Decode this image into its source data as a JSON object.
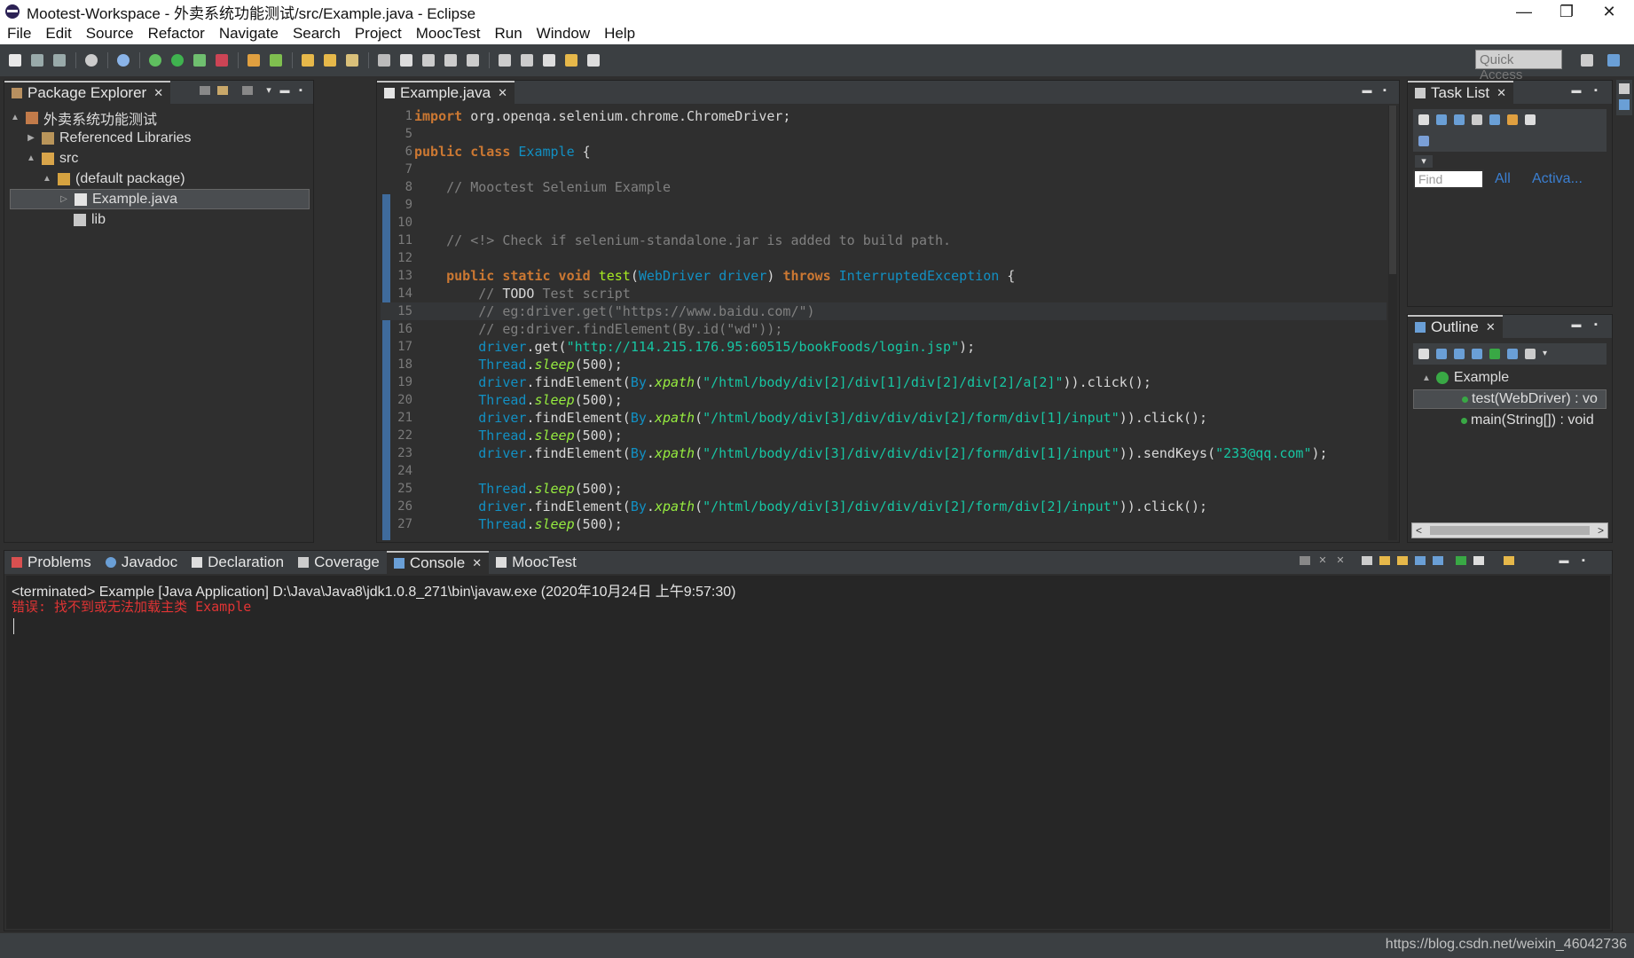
{
  "window": {
    "title": "Mootest-Workspace - 外卖系统功能测试/src/Example.java - Eclipse",
    "controls": {
      "minimize": "—",
      "maximize": "❐",
      "close": "✕"
    }
  },
  "menubar": [
    "File",
    "Edit",
    "Source",
    "Refactor",
    "Navigate",
    "Search",
    "Project",
    "MoocTest",
    "Run",
    "Window",
    "Help"
  ],
  "toolbar": {
    "quick_access_placeholder": "Quick Access"
  },
  "package_explorer": {
    "tab_label": "Package Explorer",
    "tree": [
      {
        "label": "外卖系统功能测试",
        "icon": "project-icon",
        "twisty": "▲"
      },
      {
        "label": "Referenced Libraries",
        "icon": "library-icon",
        "twisty": "▶"
      },
      {
        "label": "src",
        "icon": "folder-icon",
        "twisty": "▲"
      },
      {
        "label": "(default package)",
        "icon": "package-icon",
        "twisty": "▲"
      },
      {
        "label": "Example.java",
        "icon": "java-file-icon",
        "twisty": "▷",
        "selected": true
      },
      {
        "label": "lib",
        "icon": "package-icon",
        "twisty": ""
      }
    ]
  },
  "editor": {
    "tab_label": "Example.java",
    "lines": [
      {
        "n": "1",
        "parts": [
          [
            "kw",
            "import"
          ],
          [
            "plain",
            " org.openqa.selenium.chrome.ChromeDriver;"
          ]
        ]
      },
      {
        "n": "5",
        "parts": []
      },
      {
        "n": "6",
        "parts": [
          [
            "kw",
            "public class"
          ],
          [
            "plain",
            " "
          ],
          [
            "cls",
            "Example"
          ],
          [
            "plain",
            " {"
          ]
        ]
      },
      {
        "n": "7",
        "parts": []
      },
      {
        "n": "8",
        "parts": [
          [
            "com",
            "    // Mooctest Selenium Example"
          ]
        ]
      },
      {
        "n": "9",
        "parts": []
      },
      {
        "n": "10",
        "parts": []
      },
      {
        "n": "11",
        "parts": [
          [
            "com",
            "    // <!> Check if selenium-standalone.jar is added to build path."
          ]
        ]
      },
      {
        "n": "12",
        "parts": []
      },
      {
        "n": "13",
        "parts": [
          [
            "plain",
            "    "
          ],
          [
            "kw",
            "public static void"
          ],
          [
            "plain",
            " "
          ],
          [
            "mth",
            "test"
          ],
          [
            "plain",
            "("
          ],
          [
            "cls",
            "WebDriver"
          ],
          [
            "plain",
            " "
          ],
          [
            "cls",
            "driver"
          ],
          [
            "plain",
            ") "
          ],
          [
            "kw",
            "throws"
          ],
          [
            "plain",
            " "
          ],
          [
            "cls",
            "InterruptedException"
          ],
          [
            "plain",
            " {"
          ]
        ]
      },
      {
        "n": "14",
        "parts": [
          [
            "com",
            "        // "
          ],
          [
            "plain",
            "TODO"
          ],
          [
            "com",
            " Test script"
          ]
        ]
      },
      {
        "n": "15",
        "parts": [
          [
            "com",
            "        // eg:driver.get(\"https://www.baidu.com/\")"
          ]
        ],
        "current": true
      },
      {
        "n": "16",
        "parts": [
          [
            "com",
            "        // eg:driver.findElement(By.id(\"wd\"));"
          ]
        ]
      },
      {
        "n": "17",
        "parts": [
          [
            "plain",
            "        "
          ],
          [
            "cls",
            "driver"
          ],
          [
            "plain",
            ".get("
          ],
          [
            "str",
            "\"http://114.215.176.95:60515/bookFoods/login.jsp\""
          ],
          [
            "plain",
            ");"
          ]
        ]
      },
      {
        "n": "18",
        "parts": [
          [
            "plain",
            "        "
          ],
          [
            "cls",
            "Thread"
          ],
          [
            "plain",
            "."
          ],
          [
            "meth-italic",
            "sleep"
          ],
          [
            "plain",
            "(500);"
          ]
        ]
      },
      {
        "n": "19",
        "parts": [
          [
            "plain",
            "        "
          ],
          [
            "cls",
            "driver"
          ],
          [
            "plain",
            ".findElement("
          ],
          [
            "cls",
            "By"
          ],
          [
            "plain",
            "."
          ],
          [
            "meth-italic",
            "xpath"
          ],
          [
            "plain",
            "("
          ],
          [
            "str",
            "\"/html/body/div[2]/div[1]/div[2]/div[2]/a[2]\""
          ],
          [
            "plain",
            ")).click();"
          ]
        ]
      },
      {
        "n": "20",
        "parts": [
          [
            "plain",
            "        "
          ],
          [
            "cls",
            "Thread"
          ],
          [
            "plain",
            "."
          ],
          [
            "meth-italic",
            "sleep"
          ],
          [
            "plain",
            "(500);"
          ]
        ]
      },
      {
        "n": "21",
        "parts": [
          [
            "plain",
            "        "
          ],
          [
            "cls",
            "driver"
          ],
          [
            "plain",
            ".findElement("
          ],
          [
            "cls",
            "By"
          ],
          [
            "plain",
            "."
          ],
          [
            "meth-italic",
            "xpath"
          ],
          [
            "plain",
            "("
          ],
          [
            "str",
            "\"/html/body/div[3]/div/div/div[2]/form/div[1]/input\""
          ],
          [
            "plain",
            ")).click();"
          ]
        ]
      },
      {
        "n": "22",
        "parts": [
          [
            "plain",
            "        "
          ],
          [
            "cls",
            "Thread"
          ],
          [
            "plain",
            "."
          ],
          [
            "meth-italic",
            "sleep"
          ],
          [
            "plain",
            "(500);"
          ]
        ]
      },
      {
        "n": "23",
        "parts": [
          [
            "plain",
            "        "
          ],
          [
            "cls",
            "driver"
          ],
          [
            "plain",
            ".findElement("
          ],
          [
            "cls",
            "By"
          ],
          [
            "plain",
            "."
          ],
          [
            "meth-italic",
            "xpath"
          ],
          [
            "plain",
            "("
          ],
          [
            "str",
            "\"/html/body/div[3]/div/div/div[2]/form/div[1]/input\""
          ],
          [
            "plain",
            ")).sendKeys("
          ],
          [
            "str",
            "\"233@qq.com\""
          ],
          [
            "plain",
            ");"
          ]
        ]
      },
      {
        "n": "24",
        "parts": []
      },
      {
        "n": "25",
        "parts": [
          [
            "plain",
            "        "
          ],
          [
            "cls",
            "Thread"
          ],
          [
            "plain",
            "."
          ],
          [
            "meth-italic",
            "sleep"
          ],
          [
            "plain",
            "(500);"
          ]
        ]
      },
      {
        "n": "26",
        "parts": [
          [
            "plain",
            "        "
          ],
          [
            "cls",
            "driver"
          ],
          [
            "plain",
            ".findElement("
          ],
          [
            "cls",
            "By"
          ],
          [
            "plain",
            "."
          ],
          [
            "meth-italic",
            "xpath"
          ],
          [
            "plain",
            "("
          ],
          [
            "str",
            "\"/html/body/div[3]/div/div/div[2]/form/div[2]/input\""
          ],
          [
            "plain",
            ")).click();"
          ]
        ]
      },
      {
        "n": "27",
        "parts": [
          [
            "plain",
            "        "
          ],
          [
            "cls",
            "Thread"
          ],
          [
            "plain",
            "."
          ],
          [
            "meth-italic",
            "sleep"
          ],
          [
            "plain",
            "(500);"
          ]
        ]
      }
    ]
  },
  "task_list": {
    "tab_label": "Task List",
    "find_placeholder": "Find",
    "links": [
      "All",
      "Activa..."
    ]
  },
  "outline": {
    "tab_label": "Outline",
    "items": [
      {
        "label": "Example",
        "level": 0
      },
      {
        "label": "test(WebDriver) : vo",
        "level": 1,
        "selected": true
      },
      {
        "label": "main(String[]) : void",
        "level": 1
      }
    ]
  },
  "bottom_tabs": [
    "Problems",
    "Javadoc",
    "Declaration",
    "Coverage",
    "Console",
    "MoocTest"
  ],
  "console": {
    "header": "<terminated> Example [Java Application] D:\\Java\\Java8\\jdk1.0.8_271\\bin\\javaw.exe (2020年10月24日 上午9:57:30)",
    "error": "错误: 找不到或无法加载主类 Example"
  },
  "statusbar": {
    "watermark": "https://blog.csdn.net/weixin_46042736"
  },
  "colors": {
    "accent": "#3f6b9c",
    "error": "#e03434",
    "keyword": "#cc7832",
    "string": "#17c6a3",
    "comment": "#808080"
  }
}
